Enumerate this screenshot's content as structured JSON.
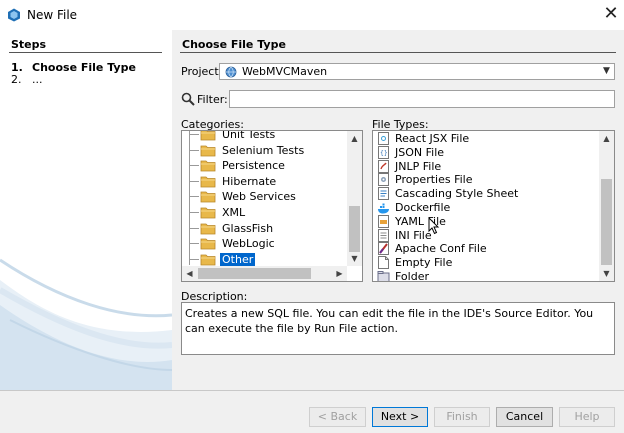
{
  "window": {
    "title": "New File",
    "close_glyph": "✕"
  },
  "steps": {
    "title": "Steps",
    "items": [
      {
        "num": "1.",
        "label": "Choose File Type"
      },
      {
        "num": "2.",
        "label": "..."
      }
    ]
  },
  "main": {
    "section_title": "Choose File Type",
    "project_label": "Project:",
    "project_value": "WebMVCMaven",
    "filter_label": "Filter:",
    "filter_value": "",
    "categories_label": "Categories:",
    "file_types_label": "File Types:",
    "categories": [
      "Unit Tests",
      "Selenium Tests",
      "Persistence",
      "Hibernate",
      "Web Services",
      "XML",
      "GlassFish",
      "WebLogic",
      "Other"
    ],
    "selected_category": "Other",
    "file_types": [
      {
        "label": "React JSX File",
        "icon": "jsx-file-icon"
      },
      {
        "label": "JSON File",
        "icon": "json-file-icon"
      },
      {
        "label": "JNLP File",
        "icon": "jnlp-file-icon"
      },
      {
        "label": "Properties File",
        "icon": "properties-file-icon"
      },
      {
        "label": "Cascading Style Sheet",
        "icon": "css-file-icon"
      },
      {
        "label": "Dockerfile",
        "icon": "docker-file-icon"
      },
      {
        "label": "YAML File",
        "icon": "yaml-file-icon"
      },
      {
        "label": "INI File",
        "icon": "ini-file-icon"
      },
      {
        "label": "Apache Conf File",
        "icon": "apache-conf-file-icon"
      },
      {
        "label": "Empty File",
        "icon": "empty-file-icon"
      },
      {
        "label": "Folder",
        "icon": "folder-icon"
      }
    ],
    "description_label": "Description:",
    "description": "Creates a new SQL file. You can edit the file in the IDE's Source Editor. You can execute the file by Run File action."
  },
  "buttons": {
    "back": "< Back",
    "next": "Next >",
    "finish": "Finish",
    "cancel": "Cancel",
    "help": "Help"
  },
  "colors": {
    "selection": "#0066cc",
    "folder": "#e8b84a",
    "panel": "#f0f0f0"
  }
}
